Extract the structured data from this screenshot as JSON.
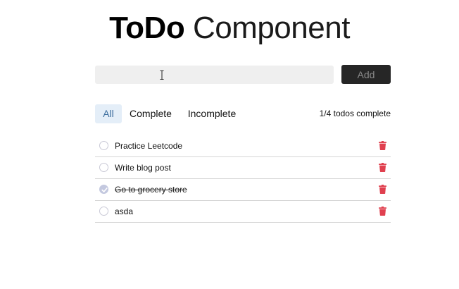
{
  "header": {
    "title_bold": "ToDo",
    "title_light": "Component"
  },
  "input": {
    "value": "",
    "placeholder": "",
    "add_label": "Add"
  },
  "filters": {
    "tabs": [
      {
        "label": "All",
        "active": true
      },
      {
        "label": "Complete",
        "active": false
      },
      {
        "label": "Incomplete",
        "active": false
      }
    ],
    "summary": "1/4 todos complete"
  },
  "todos": [
    {
      "text": "Practice Leetcode",
      "done": false
    },
    {
      "text": "Write blog post",
      "done": false
    },
    {
      "text": "Go to grocery store",
      "done": true
    },
    {
      "text": "asda",
      "done": false
    }
  ],
  "colors": {
    "delete_icon": "#e0404f",
    "active_tab_bg": "#e4eef8",
    "active_tab_text": "#3d6e9e",
    "add_button_bg": "#262626"
  },
  "icons": {
    "cursor": "text-cursor-icon",
    "check": "checkmark-icon",
    "delete": "trash-icon"
  }
}
